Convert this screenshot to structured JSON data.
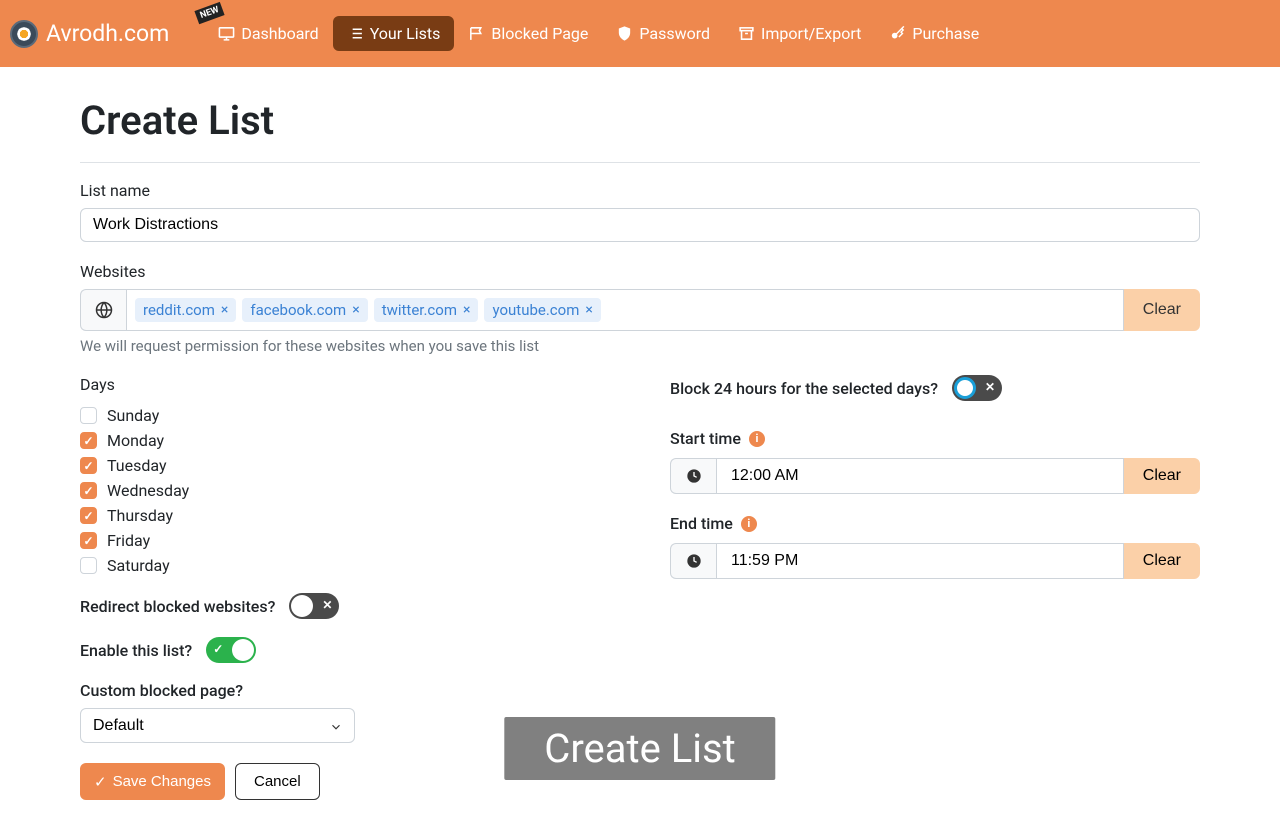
{
  "brand": "Avrodh.com",
  "nav": [
    {
      "label": "Dashboard",
      "icon": "monitor",
      "active": false,
      "badge": "NEW"
    },
    {
      "label": "Your Lists",
      "icon": "list",
      "active": true
    },
    {
      "label": "Blocked Page",
      "icon": "flag",
      "active": false
    },
    {
      "label": "Password",
      "icon": "shield",
      "active": false
    },
    {
      "label": "Import/Export",
      "icon": "archive",
      "active": false
    },
    {
      "label": "Purchase",
      "icon": "key",
      "active": false
    }
  ],
  "page_title": "Create List",
  "list_name": {
    "label": "List name",
    "value": "Work Distractions"
  },
  "websites": {
    "label": "Websites",
    "tags": [
      "reddit.com",
      "facebook.com",
      "twitter.com",
      "youtube.com"
    ],
    "clear": "Clear",
    "helper": "We will request permission for these websites when you save this list"
  },
  "days": {
    "label": "Days",
    "items": [
      {
        "name": "Sunday",
        "checked": false
      },
      {
        "name": "Monday",
        "checked": true
      },
      {
        "name": "Tuesday",
        "checked": true
      },
      {
        "name": "Wednesday",
        "checked": true
      },
      {
        "name": "Thursday",
        "checked": true
      },
      {
        "name": "Friday",
        "checked": true
      },
      {
        "name": "Saturday",
        "checked": false
      }
    ]
  },
  "block24": {
    "label": "Block 24 hours for the selected days?",
    "on": false
  },
  "start_time": {
    "label": "Start time",
    "value": "12:00 AM",
    "clear": "Clear"
  },
  "end_time": {
    "label": "End time",
    "value": "11:59 PM",
    "clear": "Clear"
  },
  "redirect": {
    "label": "Redirect blocked websites?",
    "on": false
  },
  "enable": {
    "label": "Enable this list?",
    "on": true
  },
  "custom_page": {
    "label": "Custom blocked page?",
    "value": "Default"
  },
  "save": "Save Changes",
  "cancel": "Cancel",
  "overlay": "Create List"
}
